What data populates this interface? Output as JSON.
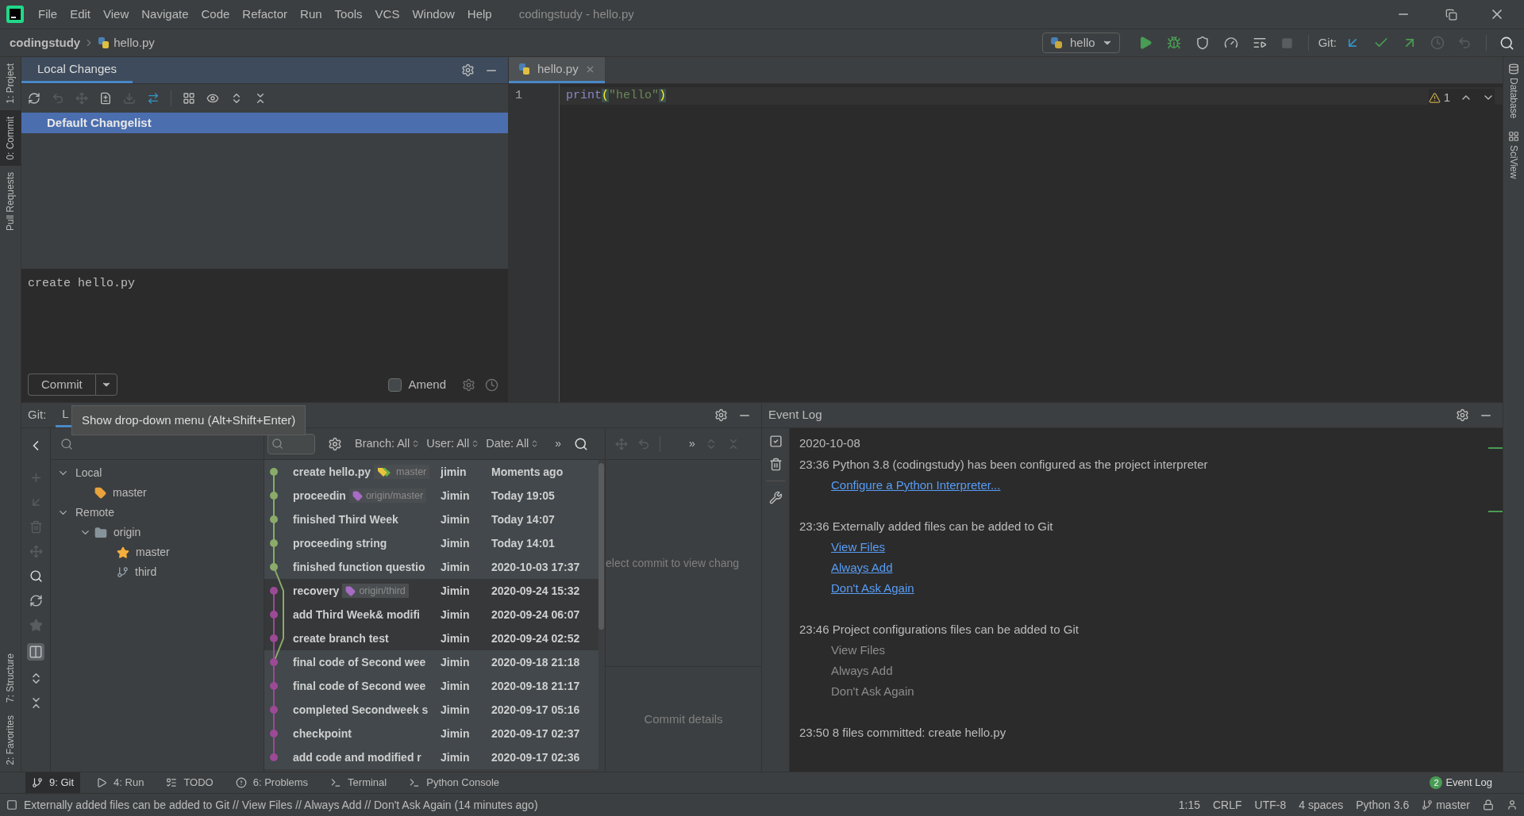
{
  "window": {
    "title": "codingstudy - hello.py",
    "menu": [
      "File",
      "Edit",
      "View",
      "Navigate",
      "Code",
      "Refactor",
      "Run",
      "Tools",
      "VCS",
      "Window",
      "Help"
    ]
  },
  "breadcrumb": [
    "codingstudy",
    "hello.py"
  ],
  "toolbar": {
    "run_config": "hello",
    "git_label": "Git:"
  },
  "left_stripe": [
    {
      "label": "1: Project",
      "selected": false
    },
    {
      "label": "0: Commit",
      "selected": true
    },
    {
      "label": "Pull Requests",
      "selected": false
    }
  ],
  "left_stripe_bottom": [
    {
      "label": "7: Structure"
    },
    {
      "label": "2: Favorites"
    }
  ],
  "right_stripe": [
    {
      "label": "Database"
    },
    {
      "label": "SciView"
    }
  ],
  "commit_panel": {
    "tab": "Local Changes",
    "changelist": "Default Changelist",
    "message": "create hello.py",
    "commit_button": "Commit",
    "amend": {
      "label": "Amend",
      "checked": false
    }
  },
  "editor": {
    "tab": "hello.py",
    "warnings": "1",
    "lines": [
      {
        "number": "1",
        "tokens": [
          {
            "text": "print",
            "kind": "builtin"
          },
          {
            "text": "(",
            "kind": "brace"
          },
          {
            "text": "\"hello\"",
            "kind": "string"
          },
          {
            "text": ")",
            "kind": "brace"
          }
        ]
      }
    ]
  },
  "git_panel": {
    "label": "Git:",
    "tab": "L",
    "tooltip": "Show drop-down menu (Alt+Shift+Enter)",
    "branches": [
      {
        "label": "Local",
        "kind": "group",
        "expanded": true,
        "children": [
          {
            "label": "master",
            "kind": "local"
          }
        ]
      },
      {
        "label": "Remote",
        "kind": "group",
        "expanded": true,
        "children": [
          {
            "label": "origin",
            "kind": "folder",
            "expanded": true,
            "children": [
              {
                "label": "master",
                "kind": "favorite"
              },
              {
                "label": "third",
                "kind": "remote"
              }
            ]
          }
        ]
      }
    ],
    "filters": [
      "Branch: All",
      "User: All",
      "Date: All"
    ],
    "more": "»",
    "commits": [
      {
        "subject": "create hello.py",
        "ref": {
          "label": "master",
          "kind": "local"
        },
        "author": "jimin",
        "date": "Moments ago",
        "color": "#8aab6a",
        "highlighted": true
      },
      {
        "subject": "proceedin",
        "ref": {
          "label": "origin/master",
          "kind": "remote"
        },
        "author": "Jimin",
        "date": "Today 19:05",
        "color": "#8aab6a",
        "highlighted": true
      },
      {
        "subject": "finished Third Week",
        "author": "Jimin",
        "date": "Today 14:07",
        "color": "#8aab6a",
        "highlighted": true
      },
      {
        "subject": "proceeding string",
        "author": "Jimin",
        "date": "Today 14:01",
        "color": "#8aab6a",
        "highlighted": true
      },
      {
        "subject": "finished function questio",
        "author": "Jimin",
        "date": "2020-10-03 17:37",
        "color": "#8aab6a",
        "highlighted": true
      },
      {
        "subject": "recovery",
        "ref": {
          "label": "origin/third",
          "kind": "remote"
        },
        "author": "Jimin",
        "date": "2020-09-24 15:32",
        "color": "#9c4a96",
        "highlighted": false
      },
      {
        "subject": "add Third Week& modifi",
        "author": "Jimin",
        "date": "2020-09-24 06:07",
        "color": "#9c4a96",
        "highlighted": false
      },
      {
        "subject": "create branch test",
        "author": "Jimin",
        "date": "2020-09-24 02:52",
        "color": "#9c4a96",
        "highlighted": false
      },
      {
        "subject": "final code of Second wee",
        "author": "Jimin",
        "date": "2020-09-18 21:18",
        "color": "#9c4a96",
        "highlighted": true
      },
      {
        "subject": "final code of Second wee",
        "author": "Jimin",
        "date": "2020-09-18 21:17",
        "color": "#9c4a96",
        "highlighted": true
      },
      {
        "subject": "completed Secondweek s",
        "author": "Jimin",
        "date": "2020-09-17 05:16",
        "color": "#9c4a96",
        "highlighted": true
      },
      {
        "subject": "checkpoint",
        "author": "Jimin",
        "date": "2020-09-17 02:37",
        "color": "#9c4a96",
        "highlighted": true
      },
      {
        "subject": "add code and modified r",
        "author": "Jimin",
        "date": "2020-09-17 02:36",
        "color": "#9c4a96",
        "highlighted": true
      }
    ],
    "details_more": "»",
    "details_hint": "elect commit to view chang",
    "details_label": "Commit details"
  },
  "event_log": {
    "title": "Event Log",
    "date": "2020-10-08",
    "entries": [
      {
        "time": "23:36",
        "message": "Python 3.8 (codingstudy) has been configured as the project interpreter",
        "links": [
          {
            "label": "Configure a Python Interpreter...",
            "active": true
          }
        ]
      },
      {
        "time": "23:36",
        "message": "Externally added files can be added to Git",
        "links": [
          {
            "label": "View Files",
            "active": true
          },
          {
            "label": "Always Add",
            "active": true
          },
          {
            "label": "Don't Ask Again",
            "active": true
          }
        ]
      },
      {
        "time": "23:46",
        "message": "Project configurations files can be added to Git",
        "links": [
          {
            "label": "View Files",
            "active": false
          },
          {
            "label": "Always Add",
            "active": false
          },
          {
            "label": "Don't Ask Again",
            "active": false
          }
        ]
      },
      {
        "time": "23:50",
        "message": "8 files committed: create hello.py"
      }
    ]
  },
  "tool_windows": [
    {
      "label": "9: Git",
      "selected": true
    },
    {
      "label": "4: Run",
      "selected": false
    },
    {
      "label": "TODO",
      "selected": false
    },
    {
      "label": "6: Problems",
      "selected": false
    },
    {
      "label": "Terminal",
      "selected": false
    },
    {
      "label": "Python Console",
      "selected": false
    }
  ],
  "event_log_button": {
    "label": "Event Log",
    "badge": "2"
  },
  "status_bar": {
    "message": "Externally added files can be added to Git // View Files // Always Add // Don't Ask Again (14 minutes ago)",
    "items": [
      "1:15",
      "CRLF",
      "UTF-8",
      "4 spaces",
      "Python 3.6"
    ],
    "branch": "master"
  }
}
